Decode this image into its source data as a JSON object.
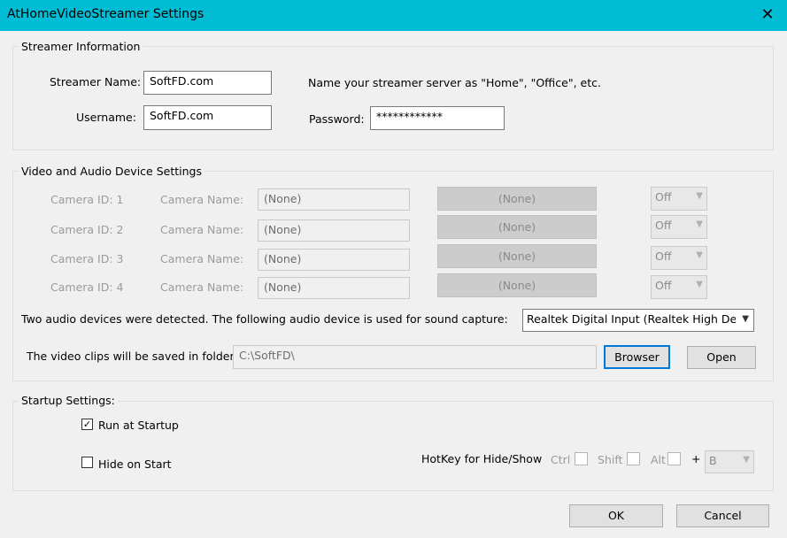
{
  "window": {
    "title": "AtHomeVideoStreamer Settings",
    "close_glyph": "✕"
  },
  "streamer": {
    "group_label": "Streamer Information",
    "name_label": "Streamer Name:",
    "name_value": "SoftFD.com",
    "name_hint": "Name your streamer server as \"Home\", \"Office\", etc.",
    "username_label": "Username:",
    "username_value": "SoftFD.com",
    "password_label": "Password:",
    "password_value": "************"
  },
  "devices": {
    "group_label": "Video and Audio Device Settings",
    "cameras": [
      {
        "id_label": "Camera ID: 1",
        "name_label": "Camera Name:",
        "name_value": "(None)",
        "device": "(None)",
        "state": "Off"
      },
      {
        "id_label": "Camera ID: 2",
        "name_label": "Camera Name:",
        "name_value": "(None)",
        "device": "(None)",
        "state": "Off"
      },
      {
        "id_label": "Camera ID: 3",
        "name_label": "Camera Name:",
        "name_value": "(None)",
        "device": "(None)",
        "state": "Off"
      },
      {
        "id_label": "Camera ID: 4",
        "name_label": "Camera Name:",
        "name_value": "(None)",
        "device": "(None)",
        "state": "Off"
      }
    ],
    "audio_text": "Two audio devices were detected.  The following audio device is used for sound capture:",
    "audio_device": "Realtek Digital Input (Realtek High Defi",
    "folder_label": "The video clips will be saved in folder:",
    "folder_value": "C:\\SoftFD\\",
    "browse_label": "Browser",
    "open_label": "Open"
  },
  "startup": {
    "group_label": "Startup Settings:",
    "run_at_startup_label": "Run at Startup",
    "run_at_startup_checked": true,
    "hide_on_start_label": "Hide on Start",
    "hide_on_start_checked": false,
    "hotkey_label": "HotKey for Hide/Show",
    "ctrl_label": "Ctrl",
    "shift_label": "Shift",
    "alt_label": "Alt",
    "plus": "+",
    "key_value": "B"
  },
  "footer": {
    "ok_label": "OK",
    "cancel_label": "Cancel"
  }
}
